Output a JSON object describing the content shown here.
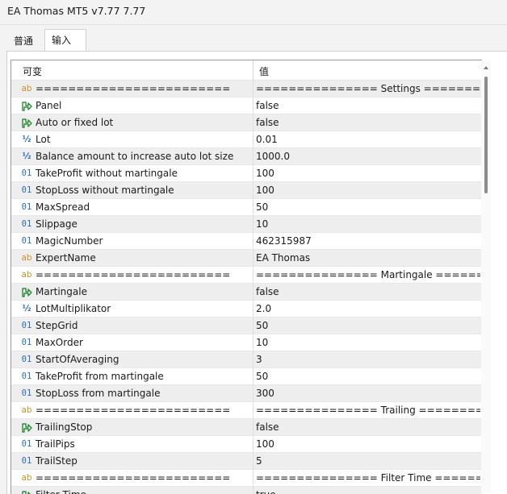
{
  "window": {
    "title": "EA Thomas MT5 v7.77 7.77"
  },
  "tabs": [
    {
      "label": "普通"
    },
    {
      "label": "输入"
    }
  ],
  "grid": {
    "headers": {
      "variable": "可变",
      "value": "值"
    },
    "rows": [
      {
        "icon": "ab",
        "name": "========================",
        "value": "=============== Settings ==========..."
      },
      {
        "icon": "bool",
        "name": "Panel",
        "value": "false"
      },
      {
        "icon": "bool",
        "name": "Auto or fixed lot",
        "value": "false"
      },
      {
        "icon": "half",
        "name": "Lot",
        "value": "0.01"
      },
      {
        "icon": "half",
        "name": "Balance amount to increase auto lot size",
        "value": "1000.0"
      },
      {
        "icon": "bin",
        "name": "TakeProfit without martingale",
        "value": "100"
      },
      {
        "icon": "bin",
        "name": "StopLoss without martingale",
        "value": "100"
      },
      {
        "icon": "bin",
        "name": "MaxSpread",
        "value": "50"
      },
      {
        "icon": "bin",
        "name": "Slippage",
        "value": "10"
      },
      {
        "icon": "bin",
        "name": "MagicNumber",
        "value": "462315987"
      },
      {
        "icon": "ab",
        "name": "ExpertName",
        "value": "EA Thomas"
      },
      {
        "icon": "ab",
        "name": "========================",
        "value": "=============== Martingale ========..."
      },
      {
        "icon": "bool",
        "name": "Martingale",
        "value": "false"
      },
      {
        "icon": "half",
        "name": "LotMultiplikator",
        "value": "2.0"
      },
      {
        "icon": "bin",
        "name": "StepGrid",
        "value": "50"
      },
      {
        "icon": "bin",
        "name": "MaxOrder",
        "value": "10"
      },
      {
        "icon": "bin",
        "name": "StartOfAveraging",
        "value": "3"
      },
      {
        "icon": "bin",
        "name": "TakeProfit from martingale",
        "value": "50"
      },
      {
        "icon": "bin",
        "name": "StopLoss from martingale",
        "value": "300"
      },
      {
        "icon": "ab",
        "name": "========================",
        "value": "=============== Trailing ==========..."
      },
      {
        "icon": "bool",
        "name": "TrailingStop",
        "value": "false"
      },
      {
        "icon": "bin",
        "name": "TrailPips",
        "value": "100"
      },
      {
        "icon": "bin",
        "name": "TrailStep",
        "value": "5"
      },
      {
        "icon": "ab",
        "name": "========================",
        "value": "=============== Filter Time ========..."
      },
      {
        "icon": "bool",
        "name": "Filter Time",
        "value": "true"
      }
    ]
  },
  "icons": {
    "ab": "string-type-icon",
    "bool": "boolean-type-icon",
    "half": "double-type-icon",
    "bin": "integer-type-icon"
  },
  "colors": {
    "alt_row": "#eeeeee",
    "string_icon": "#c8922a",
    "int_icon": "#2d6fb6",
    "bool_icon": "#2e8b3a"
  }
}
